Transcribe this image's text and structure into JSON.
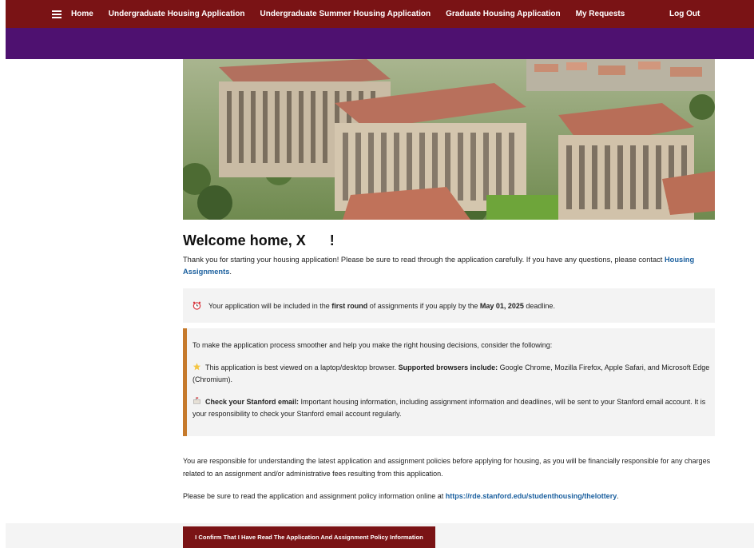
{
  "nav": {
    "items": [
      {
        "label": "Home"
      },
      {
        "label": "Undergraduate Housing Application"
      },
      {
        "label": "Undergraduate Summer Housing Application"
      },
      {
        "label": "Graduate Housing Application"
      },
      {
        "label": "My Requests"
      }
    ],
    "logout": "Log Out"
  },
  "colors": {
    "nav_bg": "#7a1315",
    "sub_bar": "#4e1170",
    "link": "#1a5f9e",
    "accent_border": "#c67a2c",
    "button_bg": "#7a1315"
  },
  "welcome": {
    "heading": "Welcome home, X      !"
  },
  "intro": {
    "text": "Thank you for starting your housing application! Please be sure to read through the application carefully. If you have any questions, please contact ",
    "link": "Housing Assignments",
    "end": "."
  },
  "notice": {
    "icon": "alarm-clock-icon",
    "pre": "Your application will be included in the ",
    "bold1": "first round",
    "mid": " of assignments if you apply by the ",
    "bold2": "May 01, 2025",
    "post": " deadline."
  },
  "tips": {
    "lead": "To make the application process smoother and help you make the right housing decisions, consider the following:",
    "browser": {
      "icon": "star-icon",
      "pre": "This application is best viewed on a laptop/desktop browser. ",
      "bold": "Supported browsers include:",
      "post": " Google Chrome, Mozilla Firefox, Apple Safari, and Microsoft Edge (Chromium)."
    },
    "email": {
      "icon": "mailbox-icon",
      "bold": "Check your Stanford email:",
      "post": " Important housing information, including assignment information and deadlines, will be sent to your Stanford email account. It is your responsibility to check your Stanford email account regularly."
    }
  },
  "policy": {
    "p1": "You are responsible for understanding the latest application and assignment policies before applying for housing, as you will be financially responsible for any charges related to an assignment and/or administrative fees resulting from this application.",
    "p2_pre": "Please be sure to read the application and assignment policy information online at ",
    "p2_link": "https://rde.stanford.edu/studenthousing/thelottery",
    "p2_post": "."
  },
  "confirm_button": "I Confirm That I Have Read The Application And Assignment Policy Information"
}
